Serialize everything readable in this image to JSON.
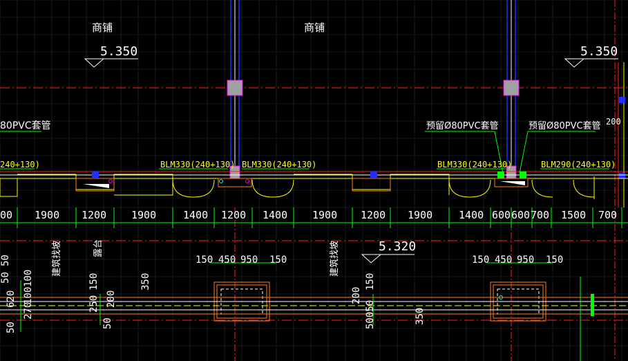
{
  "colors": {
    "background": "#000000",
    "grid": "#2a2e33",
    "white": "#ffffff",
    "yellow": "#ffff00",
    "green": "#00ff00",
    "red": "#ff2020",
    "blue": "#2030ff",
    "magenta": "#ff00ff",
    "orange": "#ff8020",
    "gray": "#a0a0a0"
  },
  "room_labels": [
    "商铺",
    "商铺"
  ],
  "elevations": [
    "5.350",
    "5.350",
    "5.320"
  ],
  "callouts": [
    "80PVC套管",
    "预留Ø80PVC套管",
    "预留Ø80PVC套管",
    "200"
  ],
  "lintels": [
    "240+130)",
    "BLM330(240+130)",
    "BLM330(240+130)",
    "BLM330(240+130)",
    "BLM290(240+130)"
  ],
  "door_dims": [
    "00",
    "1900",
    "1200",
    "1900",
    "1400",
    "1200",
    "1400",
    "1900",
    "1200",
    "1900",
    "1400",
    "600",
    "600",
    "700",
    "1500",
    "700"
  ],
  "vertical_labels": [
    "建筑找坡",
    "露台",
    "建筑找坡"
  ],
  "pit_dims_left": [
    "150",
    "450",
    "950",
    "150"
  ],
  "pit_dims_right": [
    "150",
    "450",
    "950",
    "150"
  ],
  "section_dims": [
    "50",
    "50",
    "100",
    "620",
    "100",
    "270",
    "50",
    "150",
    "250",
    "200",
    "50",
    "350",
    "200",
    "50050",
    "150",
    "350"
  ]
}
